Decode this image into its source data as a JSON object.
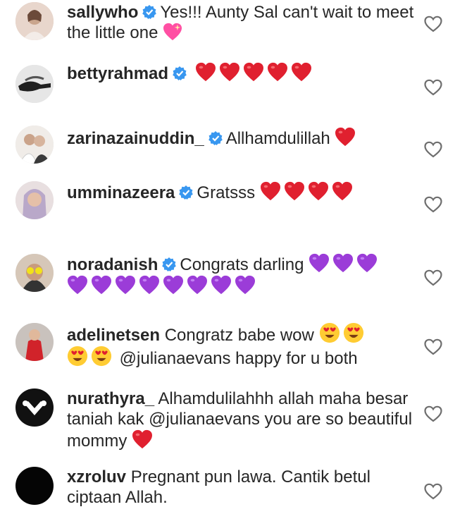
{
  "comments": [
    {
      "user": "sallywho",
      "verified": true,
      "text": "Yes!!! Aunty Sal can't wait to meet the little one",
      "avatar": "woman-portrait",
      "emoji": [
        "sparkling-heart"
      ]
    },
    {
      "user": "bettyrahmad",
      "verified": true,
      "text": "",
      "avatar": "hands-bw",
      "emoji": [
        "red-heart",
        "red-heart",
        "red-heart",
        "red-heart",
        "red-heart"
      ]
    },
    {
      "user": "zarinazainuddin_",
      "verified": true,
      "text": "Allhamdulillah",
      "avatar": "bride-couple",
      "emoji": [
        "red-heart"
      ]
    },
    {
      "user": "umminazeera",
      "verified": true,
      "text": "Gratsss",
      "avatar": "hijab-woman",
      "emoji": [
        "red-heart",
        "red-heart",
        "red-heart",
        "red-heart"
      ]
    },
    {
      "user": "noradanish",
      "verified": true,
      "text": "Congrats darling",
      "avatar": "yellow-glasses",
      "emoji": [
        "purple-heart",
        "purple-heart",
        "purple-heart",
        "purple-heart",
        "purple-heart",
        "purple-heart",
        "purple-heart",
        "purple-heart",
        "purple-heart",
        "purple-heart",
        "purple-heart"
      ]
    },
    {
      "user": "adelinetsen",
      "verified": false,
      "text": "Congratz babe wow",
      "mention": "@julianaevans",
      "text2": "happy for u both",
      "avatar": "red-dress",
      "emoji": [
        "heart-eyes",
        "heart-eyes",
        "heart-eyes",
        "heart-eyes"
      ]
    },
    {
      "user": "nurathyra_",
      "verified": false,
      "text": "Alhamdulilahhh allah maha besar taniah kak",
      "mention": "@julianaevans",
      "text2": "you are so beautiful mommy",
      "avatar": "heart-hands-bw",
      "emoji": [
        "red-heart"
      ]
    },
    {
      "user": "xzroluv",
      "verified": false,
      "text": "Pregnant pun lawa. Cantik betul ciptaan Allah.",
      "avatar": "black-circle",
      "emoji": []
    }
  ],
  "colors": {
    "verified": "#3897f0",
    "red_heart": "#e0202f",
    "purple_heart": "#9b3cd8",
    "text": "#262626",
    "like_icon": "#8e8e8e"
  }
}
